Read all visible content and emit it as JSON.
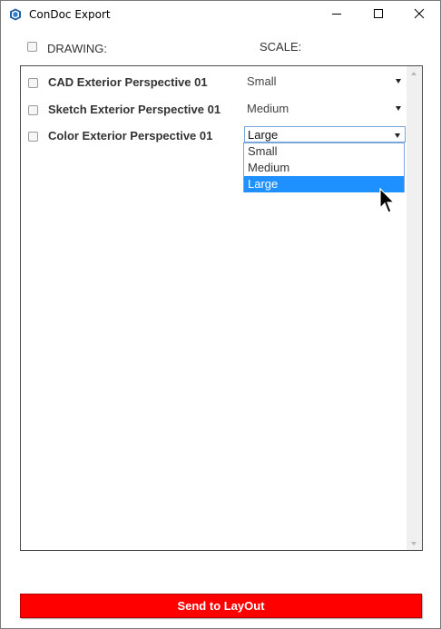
{
  "window": {
    "title": "ConDoc Export",
    "accent": "#1e90ff",
    "button_color": "#ff0000"
  },
  "header": {
    "drawing_label": "DRAWING:",
    "scale_label": "SCALE:"
  },
  "rows": [
    {
      "name": "CAD Exterior Perspective 01",
      "scale": "Small",
      "checked": false
    },
    {
      "name": "Sketch Exterior Perspective 01",
      "scale": "Medium",
      "checked": false
    },
    {
      "name": "Color Exterior Perspective 01",
      "scale": "Large",
      "checked": false
    }
  ],
  "dropdown": {
    "options": [
      "Small",
      "Medium",
      "Large"
    ],
    "selected": "Large"
  },
  "footer": {
    "send_label": "Send to LayOut"
  },
  "icons": {
    "app": "sketchup-icon",
    "minimize": "minimize-icon",
    "maximize": "maximize-icon",
    "close": "close-icon",
    "cursor": "mouse-pointer-icon"
  }
}
